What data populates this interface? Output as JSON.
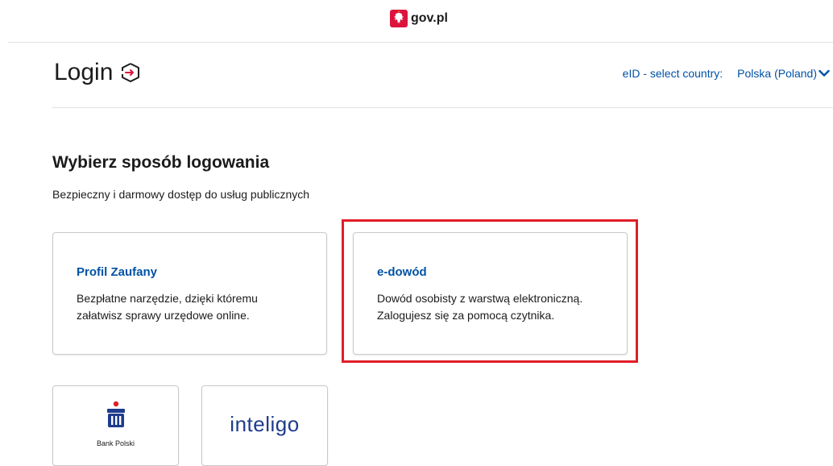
{
  "header": {
    "brand": "gov.pl",
    "logo_icon": "poland-emblem-icon"
  },
  "login": {
    "title": "Login",
    "eid_label": "eID - select country:",
    "country_value": "Polska (Poland)"
  },
  "section": {
    "title": "Wybierz sposób logowania",
    "subtitle": "Bezpieczny i darmowy dostęp do usług publicznych"
  },
  "options": [
    {
      "title": "Profil Zaufany",
      "desc_line1": "Bezpłatne narzędzie, dzięki któremu",
      "desc_line2": "załatwisz sprawy urzędowe online."
    },
    {
      "title": "e-dowód",
      "desc_line1": "Dowód osobisty z warstwą elektroniczną.",
      "desc_line2": "Zalogujesz się za pomocą czytnika."
    }
  ],
  "banks": [
    {
      "name": "Bank Polski",
      "icon": "pko-bp-logo-icon"
    },
    {
      "name": "inteligo"
    }
  ],
  "colors": {
    "link": "#0052a5",
    "highlight": "#e01e28",
    "brand_red": "#dc143c"
  }
}
